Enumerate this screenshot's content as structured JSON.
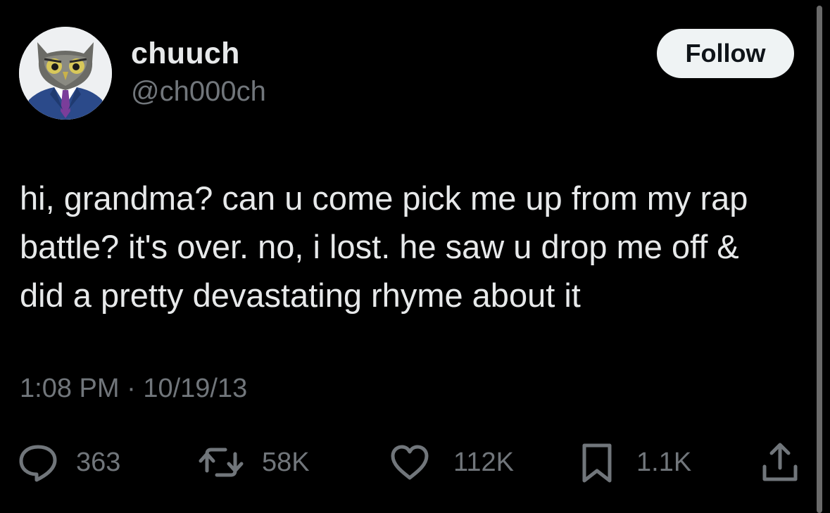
{
  "user": {
    "display_name": "chuuch",
    "handle": "@ch000ch",
    "avatar": "owl-in-suit-avatar"
  },
  "follow_button": {
    "label": "Follow"
  },
  "tweet": {
    "text": "hi, grandma? can u come pick me up from my rap\nbattle? it's over. no, i lost. he saw u drop me off &\ndid a pretty devastating rhyme about it",
    "time": "1:08 PM",
    "separator": "·",
    "date": "10/19/13"
  },
  "actions": {
    "reply": {
      "icon": "reply-bubble-icon",
      "count": "363"
    },
    "retweet": {
      "icon": "retweet-icon",
      "count": "58K"
    },
    "like": {
      "icon": "heart-icon",
      "count": "112K"
    },
    "bookmark": {
      "icon": "bookmark-icon",
      "count": "1.1K"
    },
    "share": {
      "icon": "share-icon"
    }
  },
  "colors": {
    "background": "#000000",
    "primary_text": "#e7e9ea",
    "secondary_text": "#71767b",
    "follow_button_bg": "#eff3f4",
    "follow_button_text": "#0f1419"
  }
}
